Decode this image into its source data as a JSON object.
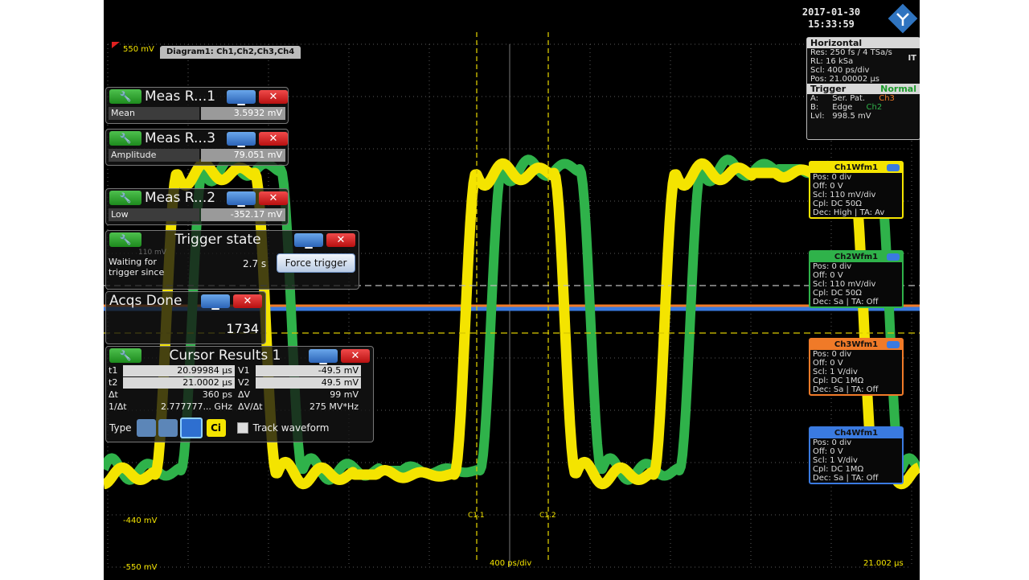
{
  "clock": {
    "date": "2017-01-30",
    "time": "15:33:59"
  },
  "diagram_tab": "Diagram1: Ch1,Ch2,Ch3,Ch4",
  "y_top_label": "550 mV",
  "y_labels": [
    {
      "text": "-440 mV"
    },
    {
      "text": "-550 mV"
    }
  ],
  "x_scale": "400 ps/div",
  "x_right": "21.002 µs",
  "cursor_markers": [
    "C1.1",
    "C1.2"
  ],
  "cursor_h_markers": [
    "C1.2",
    "C1.1"
  ],
  "meas1": {
    "title": "Meas R...1",
    "key": "Mean",
    "value": "3.5932 mV"
  },
  "meas3": {
    "title": "Meas R...3",
    "key": "Amplitude",
    "value": "79.051 mV"
  },
  "meas2": {
    "title": "Meas R...2",
    "key": "Low",
    "value": "-352.17 mV"
  },
  "trigger_state": {
    "title": "Trigger state",
    "line1": "Waiting for",
    "line2": "trigger since",
    "elapsed": "2.7 s",
    "force": "Force trigger",
    "bg_mark": "110 mV"
  },
  "acqs": {
    "title": "Acqs Done",
    "value": "1734"
  },
  "cursor": {
    "title": "Cursor Results 1",
    "rows": [
      {
        "k": "t1",
        "v": "20.99984 µs",
        "k2": "V1",
        "v2": "-49.5 mV"
      },
      {
        "k": "t2",
        "v": "21.0002 µs",
        "k2": "V2",
        "v2": "49.5 mV"
      },
      {
        "k": "Δt",
        "v": "360 ps",
        "k2": "ΔV",
        "v2": "99 mV"
      },
      {
        "k": "1/Δt",
        "v": "2.777777... GHz",
        "k2": "ΔV/Δt",
        "v2": "275 MV*Hz"
      }
    ],
    "type_label": "Type",
    "ci_label": "Ci",
    "track": "Track waveform"
  },
  "horizontal": {
    "title": "Horizontal",
    "lines": [
      "Res: 250 fs / 4 TSa/s",
      "RL: 16 kSa",
      "Scl: 400 ps/div",
      "Pos: 21.00002 µs"
    ],
    "it": "IT",
    "trigger_title": "Trigger",
    "trigger_mode": "Normal",
    "trig_lines": [
      {
        "a": "A:",
        "b": "Ser. Pat.",
        "c": "Ch3"
      },
      {
        "a": "B:",
        "b": "Edge",
        "c": "Ch2"
      },
      {
        "a": "Lvl:",
        "b": "998.5 mV",
        "c": ""
      }
    ]
  },
  "channels": [
    {
      "title": "Ch1Wfm1",
      "color": "#f4e400",
      "lines": [
        "Pos: 0 div",
        "Off: 0 V",
        "Scl: 110 mV/div",
        "Cpl: DC 50Ω",
        "Dec: High | TA: Av"
      ]
    },
    {
      "title": "Ch2Wfm1",
      "color": "#2fb24a",
      "lines": [
        "Pos: 0 div",
        "Off: 0 V",
        "Scl: 110 mV/div",
        "Cpl: DC 50Ω",
        "Dec: Sa | TA: Off"
      ]
    },
    {
      "title": "Ch3Wfm1",
      "color": "#f07a28",
      "lines": [
        "Pos: 0 div",
        "Off: 0 V",
        "Scl: 1 V/div",
        "Cpl: DC 1MΩ",
        "Dec: Sa | TA: Off"
      ]
    },
    {
      "title": "Ch4Wfm1",
      "color": "#3a7ae0",
      "lines": [
        "Pos: 0 div",
        "Off: 0 V",
        "Scl: 1 V/div",
        "Cpl: DC 1MΩ",
        "Dec: Sa | TA: Off"
      ]
    }
  ],
  "colors": {
    "ch1": "#f4e400",
    "ch2": "#2fb24a",
    "ch3": "#f07a28",
    "ch4": "#3a7ae0",
    "grid": "#5a5a5a"
  }
}
